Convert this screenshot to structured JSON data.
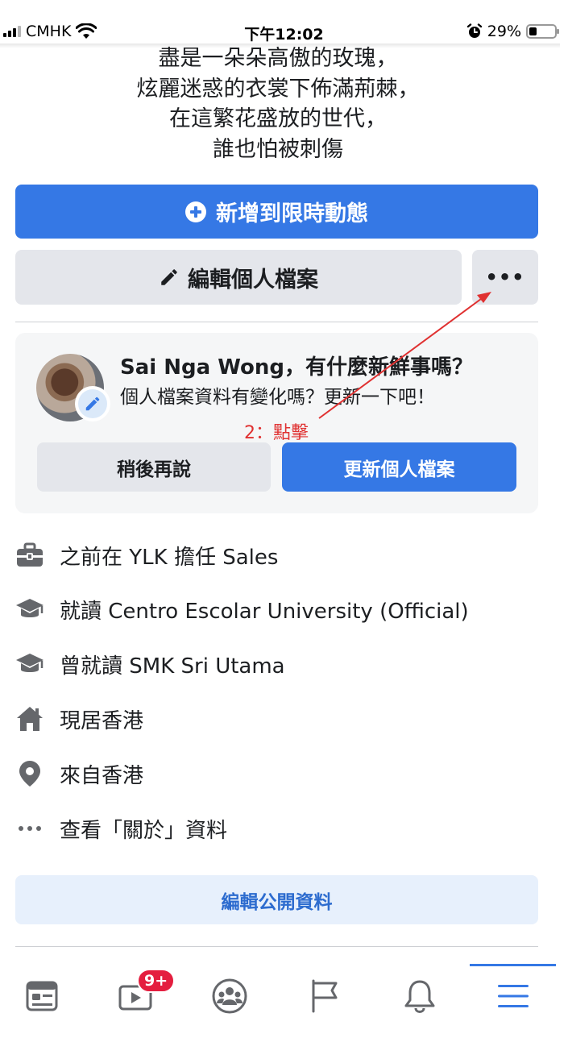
{
  "status_bar": {
    "carrier": "CMHK",
    "time": "下午12:02",
    "battery_percent": "29%",
    "battery_level": 0.29
  },
  "bio": {
    "lines": [
      "盡是一朵朵高傲的玫瑰，",
      "炫麗迷惑的衣裳下佈滿荊棘，",
      "在這繁花盛放的世代，",
      "誰也怕被刺傷"
    ]
  },
  "actions": {
    "add_story_label": "新增到限時動態",
    "edit_profile_label": "編輯個人檔案",
    "more_label": "•••"
  },
  "update_card": {
    "title": "Sai Nga Wong，有什麼新鮮事嗎？",
    "subtitle": "個人檔案資料有變化嗎？更新一下吧！",
    "later_label": "稍後再說",
    "update_label": "更新個人檔案"
  },
  "annotation": {
    "text": "2：點擊",
    "color": "#e03131"
  },
  "intro": {
    "items": [
      {
        "icon": "briefcase-icon",
        "text": "之前在 YLK 擔任 Sales"
      },
      {
        "icon": "graduation-cap-icon",
        "text": "就讀 Centro Escolar University (Official)"
      },
      {
        "icon": "graduation-cap-icon",
        "text": "曾就讀 SMK Sri Utama"
      },
      {
        "icon": "home-icon",
        "text": "現居香港"
      },
      {
        "icon": "location-pin-icon",
        "text": "來自香港"
      },
      {
        "icon": "more-dots-icon",
        "text": "查看「關於」資料"
      }
    ],
    "edit_public_label": "編輯公開資料"
  },
  "bottom_nav": {
    "items": [
      "news-feed-icon",
      "watch-video-icon",
      "groups-icon",
      "pages-flag-icon",
      "notifications-bell-icon",
      "menu-icon"
    ],
    "watch_badge": "9+",
    "active": "menu-icon"
  },
  "colors": {
    "accent": "#3578e5",
    "badge": "#e41e3f",
    "icon_gray": "#65676b"
  }
}
